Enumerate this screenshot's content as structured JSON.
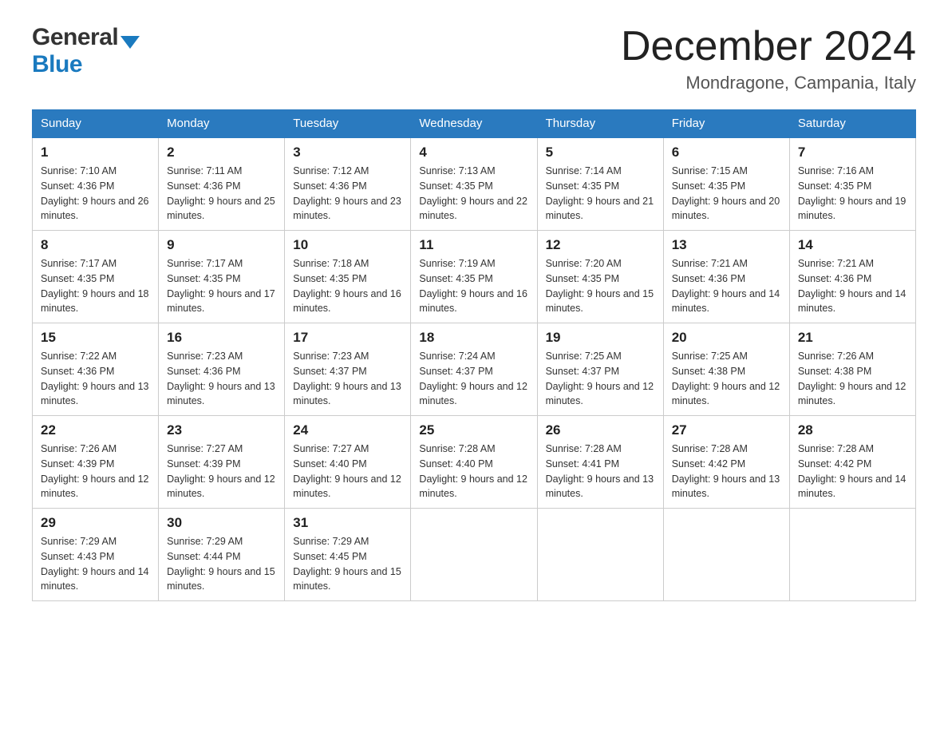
{
  "header": {
    "logo_general": "General",
    "logo_blue": "Blue",
    "month_year": "December 2024",
    "location": "Mondragone, Campania, Italy"
  },
  "columns": [
    "Sunday",
    "Monday",
    "Tuesday",
    "Wednesday",
    "Thursday",
    "Friday",
    "Saturday"
  ],
  "weeks": [
    [
      {
        "day": "1",
        "sunrise": "Sunrise: 7:10 AM",
        "sunset": "Sunset: 4:36 PM",
        "daylight": "Daylight: 9 hours and 26 minutes."
      },
      {
        "day": "2",
        "sunrise": "Sunrise: 7:11 AM",
        "sunset": "Sunset: 4:36 PM",
        "daylight": "Daylight: 9 hours and 25 minutes."
      },
      {
        "day": "3",
        "sunrise": "Sunrise: 7:12 AM",
        "sunset": "Sunset: 4:36 PM",
        "daylight": "Daylight: 9 hours and 23 minutes."
      },
      {
        "day": "4",
        "sunrise": "Sunrise: 7:13 AM",
        "sunset": "Sunset: 4:35 PM",
        "daylight": "Daylight: 9 hours and 22 minutes."
      },
      {
        "day": "5",
        "sunrise": "Sunrise: 7:14 AM",
        "sunset": "Sunset: 4:35 PM",
        "daylight": "Daylight: 9 hours and 21 minutes."
      },
      {
        "day": "6",
        "sunrise": "Sunrise: 7:15 AM",
        "sunset": "Sunset: 4:35 PM",
        "daylight": "Daylight: 9 hours and 20 minutes."
      },
      {
        "day": "7",
        "sunrise": "Sunrise: 7:16 AM",
        "sunset": "Sunset: 4:35 PM",
        "daylight": "Daylight: 9 hours and 19 minutes."
      }
    ],
    [
      {
        "day": "8",
        "sunrise": "Sunrise: 7:17 AM",
        "sunset": "Sunset: 4:35 PM",
        "daylight": "Daylight: 9 hours and 18 minutes."
      },
      {
        "day": "9",
        "sunrise": "Sunrise: 7:17 AM",
        "sunset": "Sunset: 4:35 PM",
        "daylight": "Daylight: 9 hours and 17 minutes."
      },
      {
        "day": "10",
        "sunrise": "Sunrise: 7:18 AM",
        "sunset": "Sunset: 4:35 PM",
        "daylight": "Daylight: 9 hours and 16 minutes."
      },
      {
        "day": "11",
        "sunrise": "Sunrise: 7:19 AM",
        "sunset": "Sunset: 4:35 PM",
        "daylight": "Daylight: 9 hours and 16 minutes."
      },
      {
        "day": "12",
        "sunrise": "Sunrise: 7:20 AM",
        "sunset": "Sunset: 4:35 PM",
        "daylight": "Daylight: 9 hours and 15 minutes."
      },
      {
        "day": "13",
        "sunrise": "Sunrise: 7:21 AM",
        "sunset": "Sunset: 4:36 PM",
        "daylight": "Daylight: 9 hours and 14 minutes."
      },
      {
        "day": "14",
        "sunrise": "Sunrise: 7:21 AM",
        "sunset": "Sunset: 4:36 PM",
        "daylight": "Daylight: 9 hours and 14 minutes."
      }
    ],
    [
      {
        "day": "15",
        "sunrise": "Sunrise: 7:22 AM",
        "sunset": "Sunset: 4:36 PM",
        "daylight": "Daylight: 9 hours and 13 minutes."
      },
      {
        "day": "16",
        "sunrise": "Sunrise: 7:23 AM",
        "sunset": "Sunset: 4:36 PM",
        "daylight": "Daylight: 9 hours and 13 minutes."
      },
      {
        "day": "17",
        "sunrise": "Sunrise: 7:23 AM",
        "sunset": "Sunset: 4:37 PM",
        "daylight": "Daylight: 9 hours and 13 minutes."
      },
      {
        "day": "18",
        "sunrise": "Sunrise: 7:24 AM",
        "sunset": "Sunset: 4:37 PM",
        "daylight": "Daylight: 9 hours and 12 minutes."
      },
      {
        "day": "19",
        "sunrise": "Sunrise: 7:25 AM",
        "sunset": "Sunset: 4:37 PM",
        "daylight": "Daylight: 9 hours and 12 minutes."
      },
      {
        "day": "20",
        "sunrise": "Sunrise: 7:25 AM",
        "sunset": "Sunset: 4:38 PM",
        "daylight": "Daylight: 9 hours and 12 minutes."
      },
      {
        "day": "21",
        "sunrise": "Sunrise: 7:26 AM",
        "sunset": "Sunset: 4:38 PM",
        "daylight": "Daylight: 9 hours and 12 minutes."
      }
    ],
    [
      {
        "day": "22",
        "sunrise": "Sunrise: 7:26 AM",
        "sunset": "Sunset: 4:39 PM",
        "daylight": "Daylight: 9 hours and 12 minutes."
      },
      {
        "day": "23",
        "sunrise": "Sunrise: 7:27 AM",
        "sunset": "Sunset: 4:39 PM",
        "daylight": "Daylight: 9 hours and 12 minutes."
      },
      {
        "day": "24",
        "sunrise": "Sunrise: 7:27 AM",
        "sunset": "Sunset: 4:40 PM",
        "daylight": "Daylight: 9 hours and 12 minutes."
      },
      {
        "day": "25",
        "sunrise": "Sunrise: 7:28 AM",
        "sunset": "Sunset: 4:40 PM",
        "daylight": "Daylight: 9 hours and 12 minutes."
      },
      {
        "day": "26",
        "sunrise": "Sunrise: 7:28 AM",
        "sunset": "Sunset: 4:41 PM",
        "daylight": "Daylight: 9 hours and 13 minutes."
      },
      {
        "day": "27",
        "sunrise": "Sunrise: 7:28 AM",
        "sunset": "Sunset: 4:42 PM",
        "daylight": "Daylight: 9 hours and 13 minutes."
      },
      {
        "day": "28",
        "sunrise": "Sunrise: 7:28 AM",
        "sunset": "Sunset: 4:42 PM",
        "daylight": "Daylight: 9 hours and 14 minutes."
      }
    ],
    [
      {
        "day": "29",
        "sunrise": "Sunrise: 7:29 AM",
        "sunset": "Sunset: 4:43 PM",
        "daylight": "Daylight: 9 hours and 14 minutes."
      },
      {
        "day": "30",
        "sunrise": "Sunrise: 7:29 AM",
        "sunset": "Sunset: 4:44 PM",
        "daylight": "Daylight: 9 hours and 15 minutes."
      },
      {
        "day": "31",
        "sunrise": "Sunrise: 7:29 AM",
        "sunset": "Sunset: 4:45 PM",
        "daylight": "Daylight: 9 hours and 15 minutes."
      },
      null,
      null,
      null,
      null
    ]
  ]
}
